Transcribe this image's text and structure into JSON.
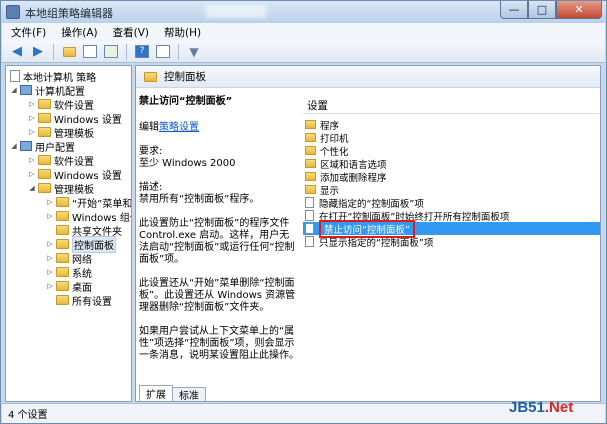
{
  "window": {
    "title": "本地组策略编辑器",
    "blurred_title": "Windows 服务"
  },
  "menubar": {
    "items": [
      "文件(F)",
      "操作(A)",
      "查看(V)",
      "帮助(H)"
    ]
  },
  "tree": {
    "root": "本地计算机 策略",
    "computer_config": "计算机配置",
    "cc_items": [
      "软件设置",
      "Windows 设置",
      "管理模板"
    ],
    "user_config": "用户配置",
    "uc_items": [
      "软件设置",
      "Windows 设置",
      "管理模板"
    ],
    "admin_children": [
      "“开始”菜单和",
      "Windows 组件",
      "共享文件夹",
      "控制面板",
      "网络",
      "系统",
      "桌面",
      "所有设置"
    ]
  },
  "right": {
    "header": "控制面板",
    "desc_title": "禁止访问“控制面板”",
    "edit_prefix": "编辑",
    "edit_link": "策略设置",
    "req_label": "要求:",
    "req_value": "至少 Windows 2000",
    "desc_label": "描述:",
    "desc_value": "禁用所有“控制面板”程序。",
    "para1": "此设置防止“控制面板”的程序文件 Control.exe 启动。这样，用户无法启动“控制面板”或运行任何“控制面板”项。",
    "para2": "此设置还从“开始”菜单删除“控制面板”。此设置还从 Windows 资源管理器删除“控制面板”文件夹。",
    "para3": "如果用户尝试从上下文菜单上的“属性”项选择“控制面板”项，则会显示一条消息，说明某设置阻止此操作。",
    "column_header": "设置",
    "folders": [
      "程序",
      "打印机",
      "个性化",
      "区域和语言选项",
      "添加或删除程序",
      "显示"
    ],
    "policies": [
      "隐藏指定的“控制面板”项",
      "在打开“控制面板”时始终打开所有控制面板项",
      "禁止访问“控制面板”",
      "只显示指定的“控制面板”项"
    ],
    "tabs": [
      "扩展",
      "标准"
    ]
  },
  "status": {
    "text": "4 个设置"
  },
  "watermark": {
    "part1": "JB51",
    "part2": ".Net"
  }
}
